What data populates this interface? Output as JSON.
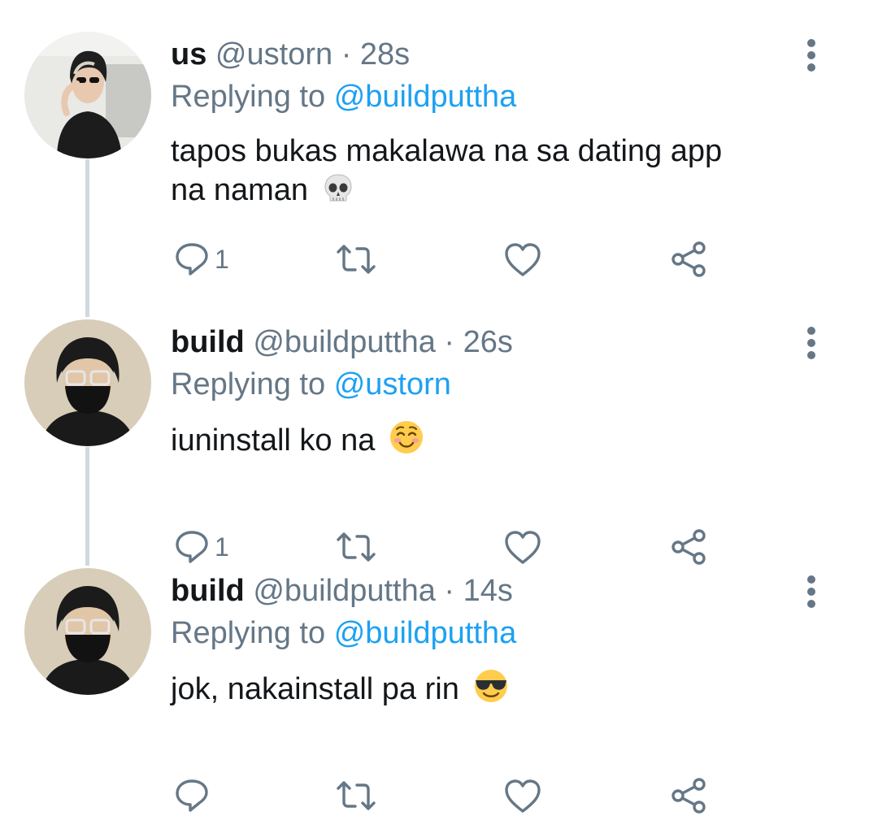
{
  "tweets": [
    {
      "name": "us",
      "handle": "@ustorn",
      "separator": "·",
      "time": "28s",
      "replying_prefix": "Replying to",
      "replying_handle": "@buildputtha",
      "text_line1": "tapos bukas makalawa na sa dating app",
      "text_line2": "na naman",
      "emoji": "skull-emoji",
      "reply_count": "1"
    },
    {
      "name": "build",
      "handle": "@buildputtha",
      "separator": "·",
      "time": "26s",
      "replying_prefix": "Replying to",
      "replying_handle": "@ustorn",
      "text_line1": "iuninstall ko na",
      "emoji": "smiling-face-emoji",
      "reply_count": "1"
    },
    {
      "name": "build",
      "handle": "@buildputtha",
      "separator": "·",
      "time": "14s",
      "replying_prefix": "Replying to",
      "replying_handle": "@buildputtha",
      "text_line1": "jok, nakainstall pa rin",
      "emoji": "sunglasses-emoji",
      "reply_count": ""
    }
  ],
  "icons": {
    "reply": "reply-icon",
    "retweet": "retweet-icon",
    "like": "heart-icon",
    "share": "share-icon",
    "more": "more-vertical-icon"
  },
  "colors": {
    "text": "#14171a",
    "secondary": "#657786",
    "link": "#1da1f2",
    "thread_line": "#cfd9de"
  }
}
